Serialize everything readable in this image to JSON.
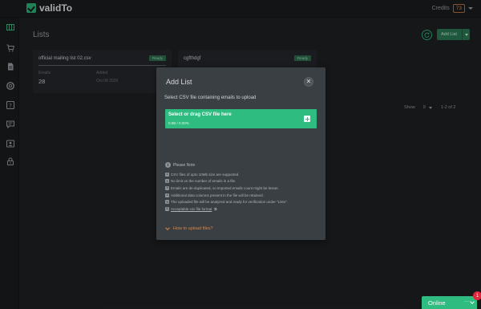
{
  "header": {
    "app_name": "validTo",
    "credits_label": "Credits",
    "credits_value": "73"
  },
  "sidebar": {
    "items": [
      {
        "icon": "columns-icon",
        "active": true
      },
      {
        "icon": "cart-icon"
      },
      {
        "icon": "document-icon"
      },
      {
        "icon": "support-icon"
      },
      {
        "icon": "help-icon"
      },
      {
        "icon": "chat-icon"
      },
      {
        "icon": "id-card-icon"
      },
      {
        "icon": "lock-icon"
      }
    ]
  },
  "main": {
    "title": "Lists",
    "add_list_label": "Add List",
    "cards": [
      {
        "title": "official mailing list 02.csv",
        "status": "Ready",
        "progress": 1.0,
        "emails_label": "Emails",
        "emails_value": "28",
        "added_label": "Added",
        "added_value": "Oct 08 2020"
      },
      {
        "title": "cgfthdgf",
        "status": "Ready"
      }
    ],
    "pager": {
      "show_label": "Show",
      "page_size": "9",
      "range": "1-2 of 2"
    }
  },
  "modal": {
    "title": "Add List",
    "close_glyph": "✕",
    "subtitle": "Select CSV file containing emails to upload",
    "dropzone": {
      "title": "Select or drag CSV file here",
      "status": "0.0B / 0.00%"
    },
    "note_title": "Please Note",
    "notes": [
      "CSV files of upto 10Mb size are supported.",
      "No limit on the number of emails in a file.",
      "Emails are de-duplicated, so imported emails count might be lesser.",
      "Additional data columns present in the file will be retained.",
      "The uploaded file will be analyzed and ready for verification under \"Lists\".",
      "Acceptable csv file format"
    ],
    "how_to_label": "How to upload files?"
  },
  "chat": {
    "label": "Online",
    "dots": "···",
    "badge": "1"
  },
  "colors": {
    "accent": "#2fbc80",
    "warning": "#d9844a",
    "background": "#1e2123"
  }
}
